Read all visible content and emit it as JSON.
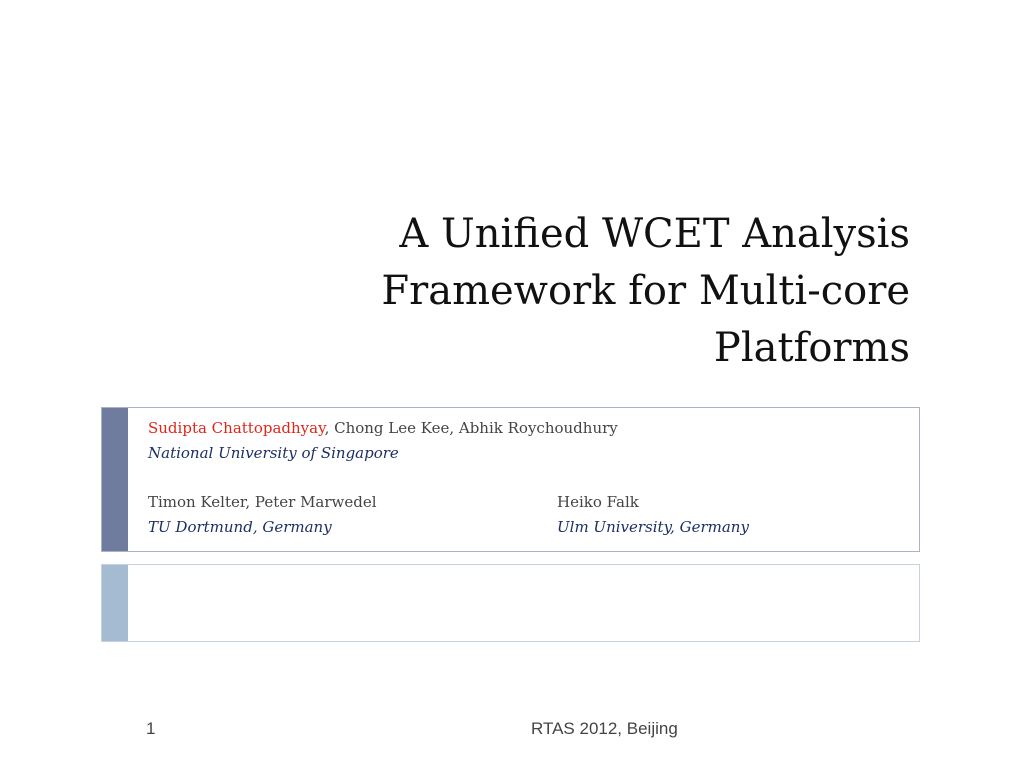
{
  "title": {
    "lines": [
      "A Unified WCET Analysis",
      "Framework for Multi-core",
      "Platforms"
    ]
  },
  "authors": {
    "group1": {
      "lead_author": "Sudipta Chattopadhyay",
      "co_authors": ", Chong Lee Kee, Abhik Roychoudhury",
      "affiliation": "National University of Singapore"
    },
    "group2": {
      "names": "Timon Kelter, Peter Marwedel",
      "affiliation": "TU Dortmund, Germany"
    },
    "group3": {
      "names": "Heiko Falk",
      "affiliation": "Ulm University, Germany"
    }
  },
  "footer": {
    "page_number": "1",
    "venue": "RTAS 2012, Beijing"
  },
  "colors": {
    "lead_author": "#e0261b",
    "affiliation": "#1c2f66",
    "bar_primary": "#6f7c9d",
    "bar_secondary": "#a5bbd2"
  }
}
